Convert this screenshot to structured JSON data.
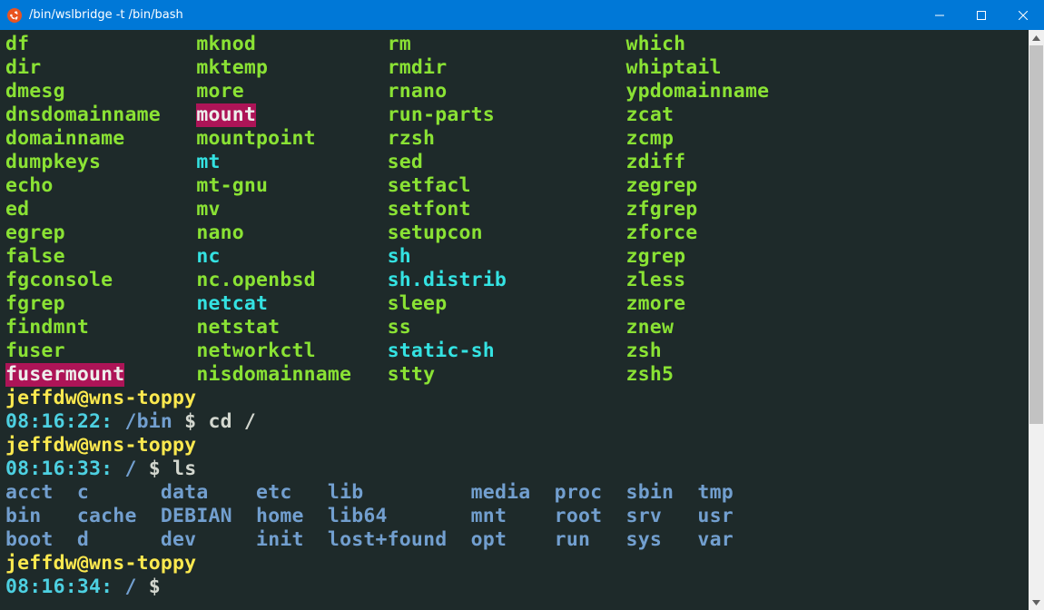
{
  "window": {
    "title": "/bin/wslbridge -t /bin/bash"
  },
  "cols": {
    "w0": 16,
    "w1": 16,
    "w2": 20,
    "w3": 20
  },
  "listing": [
    [
      {
        "t": "df",
        "c": "green"
      },
      {
        "t": "mknod",
        "c": "green"
      },
      {
        "t": "rm",
        "c": "green"
      },
      {
        "t": "which",
        "c": "green"
      }
    ],
    [
      {
        "t": "dir",
        "c": "green"
      },
      {
        "t": "mktemp",
        "c": "green"
      },
      {
        "t": "rmdir",
        "c": "green"
      },
      {
        "t": "whiptail",
        "c": "green"
      }
    ],
    [
      {
        "t": "dmesg",
        "c": "green"
      },
      {
        "t": "more",
        "c": "green"
      },
      {
        "t": "rnano",
        "c": "green"
      },
      {
        "t": "ypdomainname",
        "c": "green"
      }
    ],
    [
      {
        "t": "dnsdomainname",
        "c": "green"
      },
      {
        "t": "mount",
        "c": "hilite"
      },
      {
        "t": "run-parts",
        "c": "green"
      },
      {
        "t": "zcat",
        "c": "green"
      }
    ],
    [
      {
        "t": "domainname",
        "c": "green"
      },
      {
        "t": "mountpoint",
        "c": "green"
      },
      {
        "t": "rzsh",
        "c": "green"
      },
      {
        "t": "zcmp",
        "c": "green"
      }
    ],
    [
      {
        "t": "dumpkeys",
        "c": "green"
      },
      {
        "t": "mt",
        "c": "cyan"
      },
      {
        "t": "sed",
        "c": "green"
      },
      {
        "t": "zdiff",
        "c": "green"
      }
    ],
    [
      {
        "t": "echo",
        "c": "green"
      },
      {
        "t": "mt-gnu",
        "c": "green"
      },
      {
        "t": "setfacl",
        "c": "green"
      },
      {
        "t": "zegrep",
        "c": "green"
      }
    ],
    [
      {
        "t": "ed",
        "c": "green"
      },
      {
        "t": "mv",
        "c": "green"
      },
      {
        "t": "setfont",
        "c": "green"
      },
      {
        "t": "zfgrep",
        "c": "green"
      }
    ],
    [
      {
        "t": "egrep",
        "c": "green"
      },
      {
        "t": "nano",
        "c": "green"
      },
      {
        "t": "setupcon",
        "c": "green"
      },
      {
        "t": "zforce",
        "c": "green"
      }
    ],
    [
      {
        "t": "false",
        "c": "green"
      },
      {
        "t": "nc",
        "c": "cyan"
      },
      {
        "t": "sh",
        "c": "cyan"
      },
      {
        "t": "zgrep",
        "c": "green"
      }
    ],
    [
      {
        "t": "fgconsole",
        "c": "green"
      },
      {
        "t": "nc.openbsd",
        "c": "green"
      },
      {
        "t": "sh.distrib",
        "c": "cyan"
      },
      {
        "t": "zless",
        "c": "green"
      }
    ],
    [
      {
        "t": "fgrep",
        "c": "green"
      },
      {
        "t": "netcat",
        "c": "cyan"
      },
      {
        "t": "sleep",
        "c": "green"
      },
      {
        "t": "zmore",
        "c": "green"
      }
    ],
    [
      {
        "t": "findmnt",
        "c": "green"
      },
      {
        "t": "netstat",
        "c": "green"
      },
      {
        "t": "ss",
        "c": "green"
      },
      {
        "t": "znew",
        "c": "green"
      }
    ],
    [
      {
        "t": "fuser",
        "c": "green"
      },
      {
        "t": "networkctl",
        "c": "green"
      },
      {
        "t": "static-sh",
        "c": "cyan"
      },
      {
        "t": "zsh",
        "c": "green"
      }
    ],
    [
      {
        "t": "fusermount",
        "c": "hilite"
      },
      {
        "t": "nisdomainname",
        "c": "green"
      },
      {
        "t": "stty",
        "c": "green"
      },
      {
        "t": "zsh5",
        "c": "green"
      }
    ]
  ],
  "dirCols": [
    6,
    7,
    8,
    6,
    12,
    7,
    6,
    6,
    4
  ],
  "dir": [
    [
      "acct",
      "c",
      "data",
      "etc",
      "lib",
      "media",
      "proc",
      "sbin",
      "tmp"
    ],
    [
      "bin",
      "cache",
      "DEBIAN",
      "home",
      "lib64",
      "mnt",
      "root",
      "srv",
      "usr"
    ],
    [
      "boot",
      "d",
      "dev",
      "init",
      "lost+found",
      "opt",
      "run",
      "sys",
      "var"
    ]
  ],
  "prompts": [
    {
      "user": "jeffdw@wns-toppy",
      "time": "08:16:22:",
      "path": "/bin",
      "cmd": "cd /"
    },
    {
      "user": "jeffdw@wns-toppy",
      "time": "08:16:33:",
      "path": "/",
      "cmd": "ls"
    },
    {
      "user": "jeffdw@wns-toppy",
      "time": "08:16:34:",
      "path": "/",
      "cmd": ""
    }
  ]
}
